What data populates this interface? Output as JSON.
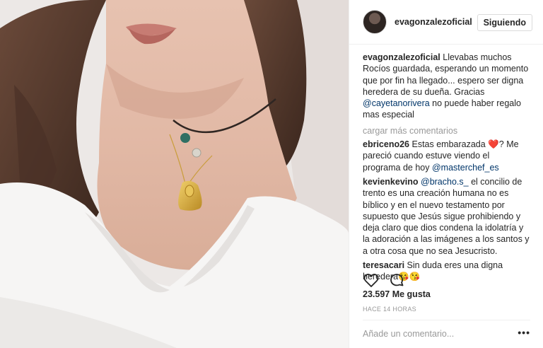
{
  "post": {
    "image_alt": "photo of woman's neck with gold medal necklace",
    "author": {
      "username": "evagonzalezoficial",
      "follow_label": "Siguiendo"
    },
    "caption": {
      "username": "evagonzalezoficial",
      "text_part1": " Llevabas muchos Rocíos guardada, esperando un momento que por fin ha llegado... espero ser digna heredera de su dueña. Gracias ",
      "mention": "@cayetanorivera",
      "text_part2": " no puede haber regalo mas especial"
    },
    "load_more_label": "cargar más comentarios",
    "comments": [
      {
        "username": "ebriceno26",
        "text_part1": " Estas embarazada ",
        "emoji": "❤️",
        "text_part2": "? Me pareció cuando estuve viendo el programa de hoy ",
        "mention": "@masterchef_es"
      },
      {
        "username": "kevienkevino",
        "mention": "@bracho.s_",
        "text": " el concilio de trento es una creación humana no es bíblico y en el nuevo testamento por supuesto que Jesús sigue prohibiendo y deja claro que dios condena la idolatría y la adoración a las imágenes a los santos y a otra cosa que no sea Jesucristo."
      },
      {
        "username": "teresacari",
        "text": " Sin duda eres una digna heredera",
        "emoji": "😘😘"
      }
    ],
    "likes_label": "23.597 Me gusta",
    "timestamp": "HACE 14 HORAS",
    "comment_placeholder": "Añade un comentario...",
    "more_options": "•••",
    "icons": {
      "like": "heart-icon",
      "comment": "comment-bubble-icon"
    }
  }
}
